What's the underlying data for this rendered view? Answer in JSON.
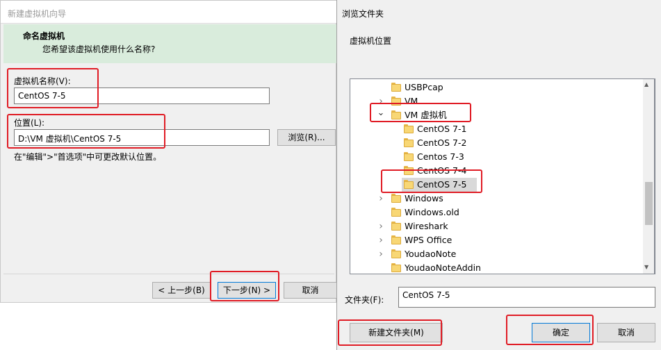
{
  "wizard": {
    "title": "新建虚拟机向导",
    "header_title": "命名虚拟机",
    "header_subtitle": "您希望该虚拟机使用什么名称?",
    "vm_name_label": "虚拟机名称(V):",
    "vm_name_value": "CentOS 7-5",
    "location_label": "位置(L):",
    "location_value": "D:\\VM 虚拟机\\CentOS 7-5",
    "browse_button": "浏览(R)...",
    "hint": "在\"编辑\">\"首选项\"中可更改默认位置。",
    "back_button": "< 上一步(B)",
    "next_button": "下一步(N) >",
    "cancel_button": "取消"
  },
  "browse": {
    "title": "浏览文件夹",
    "prompt": "虚拟机位置",
    "tree": [
      {
        "name": "USBPcap",
        "level": 0,
        "expander": "none"
      },
      {
        "name": "VM",
        "level": 0,
        "expander": "collapsed"
      },
      {
        "name": "VM 虚拟机",
        "level": 0,
        "expander": "expanded"
      },
      {
        "name": "CentOS 7-1",
        "level": 1,
        "expander": "none"
      },
      {
        "name": "CentOS 7-2",
        "level": 1,
        "expander": "none"
      },
      {
        "name": "Centos 7-3",
        "level": 1,
        "expander": "none"
      },
      {
        "name": "CentOS 7-4",
        "level": 1,
        "expander": "none"
      },
      {
        "name": "CentOS 7-5",
        "level": 1,
        "expander": "none",
        "selected": true
      },
      {
        "name": "Windows",
        "level": 0,
        "expander": "collapsed"
      },
      {
        "name": "Windows.old",
        "level": 0,
        "expander": "none"
      },
      {
        "name": "Wireshark",
        "level": 0,
        "expander": "collapsed"
      },
      {
        "name": "WPS Office",
        "level": 0,
        "expander": "collapsed"
      },
      {
        "name": "YoudaoNote",
        "level": 0,
        "expander": "collapsed"
      },
      {
        "name": "YoudaoNoteAddin",
        "level": 0,
        "expander": "none"
      }
    ],
    "folder_label": "文件夹(F):",
    "folder_value": "CentOS 7-5",
    "new_folder_button": "新建文件夹(M)",
    "ok_button": "确定",
    "cancel_button": "取消"
  },
  "colors": {
    "highlight": "#e01b24",
    "header_bg": "#d9ecdc",
    "folder": "#f8d775",
    "selection": "#d9d9d9"
  }
}
